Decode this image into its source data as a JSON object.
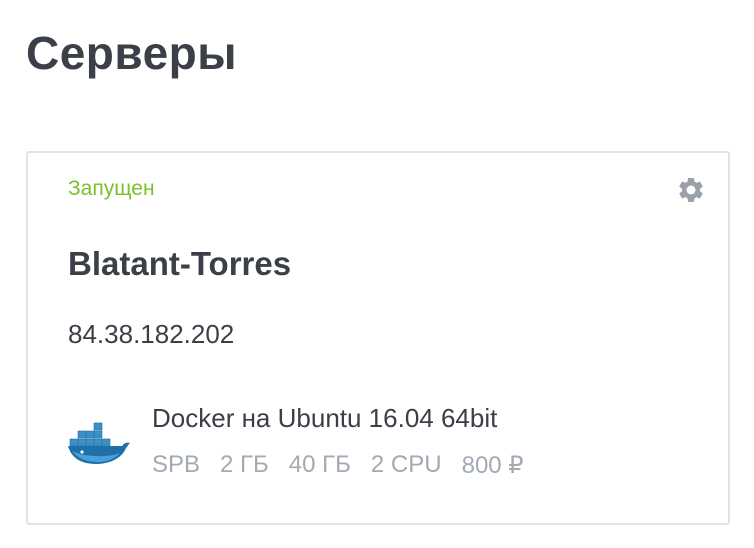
{
  "page": {
    "title": "Серверы"
  },
  "server": {
    "status": "Запущен",
    "status_color": "#7bbf2a",
    "name": "Blatant-Torres",
    "ip": "84.38.182.202",
    "image": {
      "icon": "docker-whale-icon",
      "name": "Docker на Ubuntu 16.04 64bit"
    },
    "specs": {
      "region": "SPB",
      "ram": "2 ГБ",
      "disk": "40 ГБ",
      "cpu": "2 CPU",
      "price": "800 ₽"
    },
    "settings_icon": "gear-icon"
  }
}
